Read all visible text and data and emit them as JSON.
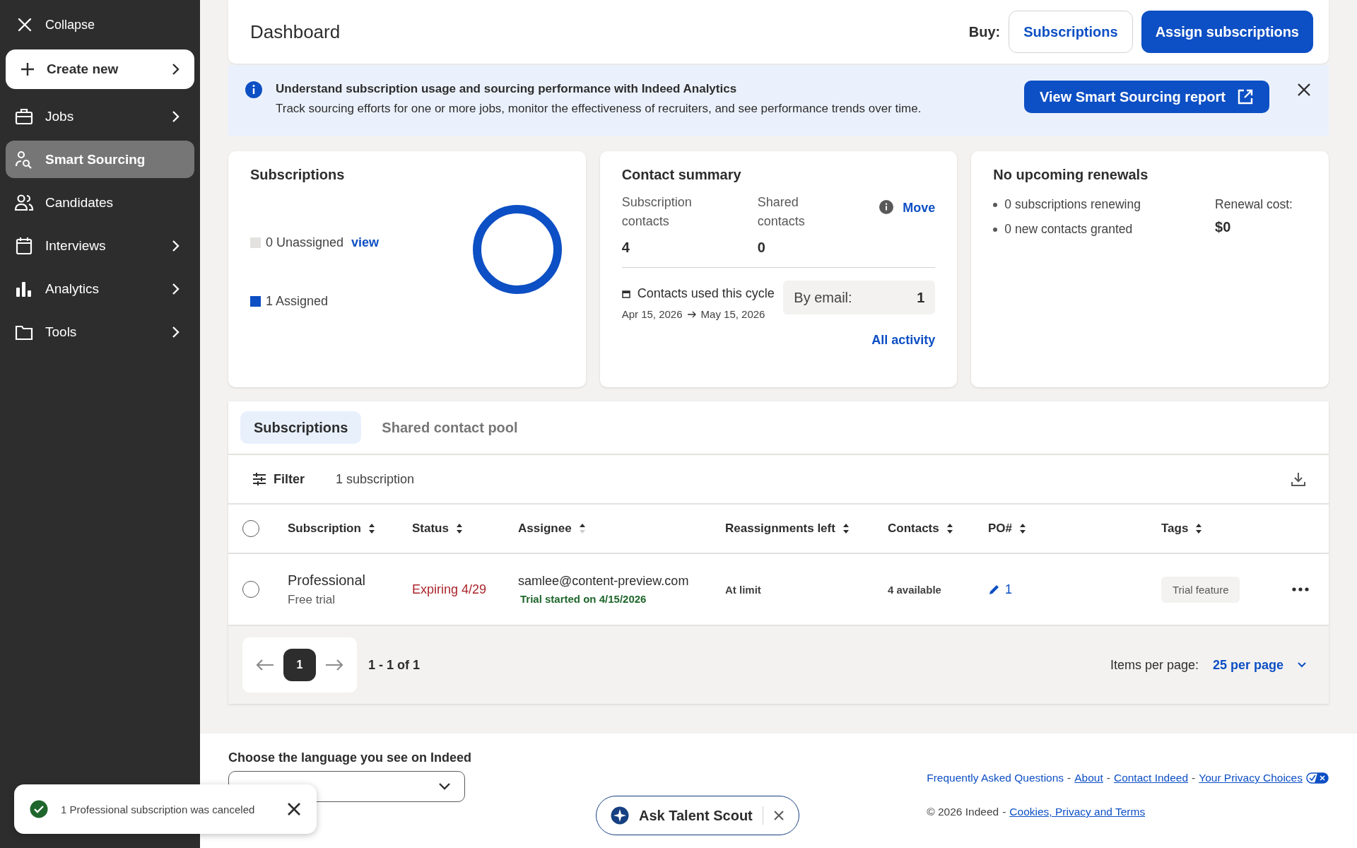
{
  "sidebar": {
    "collapse": "Collapse",
    "create_new": "Create new",
    "items": [
      {
        "label": "Jobs",
        "expandable": true,
        "selected": false
      },
      {
        "label": "Smart Sourcing",
        "expandable": false,
        "selected": true
      },
      {
        "label": "Candidates",
        "expandable": false,
        "selected": false
      },
      {
        "label": "Interviews",
        "expandable": true,
        "selected": false
      },
      {
        "label": "Analytics",
        "expandable": true,
        "selected": false
      },
      {
        "label": "Tools",
        "expandable": true,
        "selected": false
      }
    ]
  },
  "header": {
    "title": "Dashboard",
    "buy_label": "Buy:",
    "buttons": [
      {
        "label": "Subscriptions",
        "kind": "outline"
      },
      {
        "label": "Assign subscriptions",
        "kind": "primary"
      }
    ]
  },
  "banner": {
    "title": "Understand subscription usage and sourcing performance with Indeed Analytics",
    "text": "Track sourcing efforts for one or more jobs, monitor the effectiveness of recruiters, and see performance trends over time.",
    "button": "View Smart Sourcing report"
  },
  "subscriptions_card": {
    "title": "Subscriptions",
    "legend": [
      {
        "label": "0 Unassigned",
        "link": "view",
        "color": "#e4e2e0"
      },
      {
        "label": "1 Assigned",
        "color": "#0d4fc4"
      }
    ]
  },
  "contact_card": {
    "title": "Contact summary",
    "stats": [
      {
        "label": "Subscription contacts",
        "value": "4"
      },
      {
        "label": "Shared contacts",
        "value": "0"
      }
    ],
    "move": "Move",
    "cycle_label": "Contacts used this cycle",
    "cycle_start": "Apr 15, 2026",
    "cycle_end": "May 15, 2026",
    "email_label": "By email:",
    "email_value": "1",
    "all_activity": "All activity"
  },
  "renewals_card": {
    "title": "No upcoming renewals",
    "bullets": [
      "0 subscriptions renewing",
      "0 new contacts granted"
    ],
    "cost_label": "Renewal cost:",
    "cost_value": "$0"
  },
  "tabs": [
    {
      "label": "Subscriptions",
      "selected": true
    },
    {
      "label": "Shared contact pool",
      "selected": false
    }
  ],
  "toolbar": {
    "filter": "Filter",
    "count": "1 subscription"
  },
  "table": {
    "all_checked": false,
    "columns": [
      {
        "label": "Subscription",
        "sorted_ascending": false
      },
      {
        "label": "Status",
        "sorted_ascending": false
      },
      {
        "label": "Assignee",
        "sorted_ascending": true
      },
      {
        "label": "Reassignments left",
        "sorted_ascending": false
      },
      {
        "label": "Contacts",
        "sorted_ascending": false
      },
      {
        "label": "PO#",
        "sorted_ascending": false
      },
      {
        "label": "Tags",
        "sorted_ascending": false
      }
    ],
    "rows": [
      {
        "checked": false,
        "subscription": "Professional",
        "plan": "Free trial",
        "status": "Expiring 4/29",
        "assignee": "samlee@content-preview.com",
        "trial_note": "Trial started on 4/15/2026",
        "reassignments": "At limit",
        "contacts": "4 available",
        "po": "1",
        "tag": "Trial feature"
      }
    ]
  },
  "pagination": {
    "page": "1",
    "range": "1 - 1 of 1",
    "items_label": "Items per page:",
    "per_page": "25 per page"
  },
  "footer": {
    "language_label": "Choose the language you see on Indeed",
    "separator": "-",
    "links": [
      {
        "label": "Frequently Asked Questions",
        "underlined": false
      },
      {
        "label": "About",
        "underlined": true
      },
      {
        "label": "Contact Indeed",
        "underlined": true
      },
      {
        "label": "Your Privacy Choices",
        "underlined": true
      }
    ],
    "copyright": "© 2026 Indeed",
    "legal_link": "Cookies, Privacy and Terms"
  },
  "talent_scout": {
    "label": "Ask Talent Scout"
  },
  "toast": {
    "text": "1 Professional subscription was canceled"
  }
}
